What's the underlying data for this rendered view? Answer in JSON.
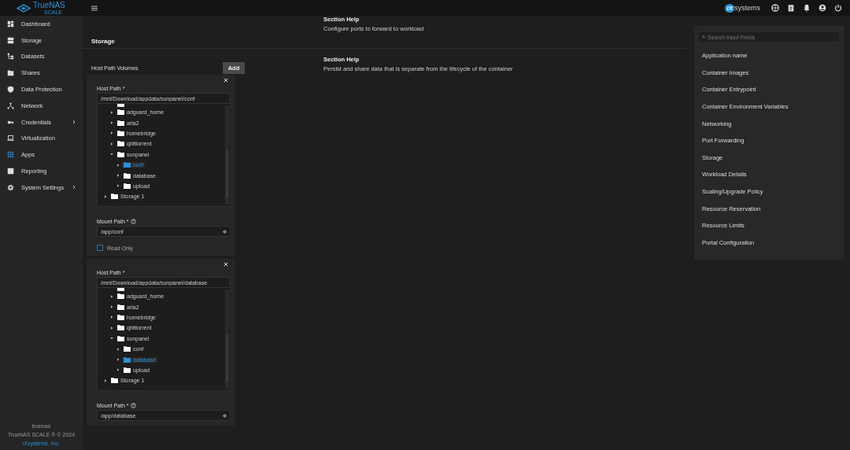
{
  "topbar": {
    "logo_text": "TrueNAS",
    "logo_sub": "SCALE",
    "vendor_mark": "iX",
    "vendor_text": "systems"
  },
  "sidebar": {
    "items": [
      {
        "label": "Dashboard",
        "selected": false,
        "has_submenu": false
      },
      {
        "label": "Storage",
        "selected": false,
        "has_submenu": false
      },
      {
        "label": "Datasets",
        "selected": false,
        "has_submenu": false
      },
      {
        "label": "Shares",
        "selected": false,
        "has_submenu": false
      },
      {
        "label": "Data Protection",
        "selected": false,
        "has_submenu": false
      },
      {
        "label": "Network",
        "selected": false,
        "has_submenu": false
      },
      {
        "label": "Credentials",
        "selected": false,
        "has_submenu": true
      },
      {
        "label": "Virtualization",
        "selected": false,
        "has_submenu": false
      },
      {
        "label": "Apps",
        "selected": true,
        "has_submenu": false
      },
      {
        "label": "Reporting",
        "selected": false,
        "has_submenu": false
      },
      {
        "label": "System Settings",
        "selected": false,
        "has_submenu": true
      }
    ],
    "hostname": "truenas",
    "copyright": "TrueNAS SCALE ® © 2024",
    "company": "iXsystems, Inc."
  },
  "sections": [
    {
      "heading": "Storage",
      "help_title": "Section Help",
      "help_text": "Configure ports to forward to workload"
    },
    {
      "label": "Host Path Volumes",
      "add_button": "Add",
      "help_title": "Section Help",
      "help_text": "Persist and share data that is separate from the lifecycle of the container",
      "volumes": [
        {
          "host_path_label": "Host Path *",
          "host_path": "/mnt/Download/appdata/sunpanel/conf",
          "tree": [
            {
              "kind": "group",
              "children": [
                {
                  "name": "adguard_home",
                  "expanded": false,
                  "selected": false
                },
                {
                  "name": "aria2",
                  "expanded": false,
                  "selected": false
                },
                {
                  "name": "homebridge",
                  "expanded": false,
                  "selected": false
                },
                {
                  "name": "qbittorrent",
                  "expanded": false,
                  "selected": false
                },
                {
                  "name": "sunpanel",
                  "expanded": true,
                  "selected": false,
                  "children": [
                    {
                      "name": "conf",
                      "expanded": false,
                      "selected": true
                    },
                    {
                      "name": "database",
                      "expanded": false,
                      "selected": false
                    },
                    {
                      "name": "upload",
                      "expanded": false,
                      "selected": false
                    }
                  ]
                }
              ]
            },
            {
              "name": "Storage 1",
              "expanded": false,
              "selected": false
            }
          ],
          "mount_path_label": "Mount Path *",
          "mount_path": "/app/conf",
          "read_only_label": "Read Only",
          "read_only": false
        },
        {
          "host_path_label": "Host Path *",
          "host_path": "/mnt/Download/appdata/sunpanel/database",
          "tree": [
            {
              "kind": "group",
              "children": [
                {
                  "name": "adguard_home",
                  "expanded": false,
                  "selected": false
                },
                {
                  "name": "aria2",
                  "expanded": false,
                  "selected": false
                },
                {
                  "name": "homebridge",
                  "expanded": false,
                  "selected": false
                },
                {
                  "name": "qbittorrent",
                  "expanded": false,
                  "selected": false
                },
                {
                  "name": "sunpanel",
                  "expanded": true,
                  "selected": false,
                  "children": [
                    {
                      "name": "conf",
                      "expanded": false,
                      "selected": false
                    },
                    {
                      "name": "database",
                      "expanded": false,
                      "selected": true
                    },
                    {
                      "name": "upload",
                      "expanded": false,
                      "selected": false
                    }
                  ]
                }
              ]
            },
            {
              "name": "Storage 1",
              "expanded": false,
              "selected": false
            }
          ],
          "mount_path_label": "Mount Path *",
          "mount_path": "/app/database"
        }
      ]
    }
  ],
  "field_nav": {
    "search_placeholder": "Search Input Fields",
    "items": [
      "Application name",
      "Container Images",
      "Container Entrypoint",
      "Container Environment Variables",
      "Networking",
      "Port Forwarding",
      "Storage",
      "Workload Details",
      "Scaling/Upgrade Policy",
      "Resource Reservation",
      "Resource Limits",
      "Portal Configuration"
    ]
  }
}
